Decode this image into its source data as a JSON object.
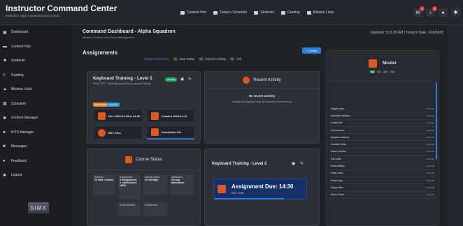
{
  "app": {
    "title": "Instructor Command Center",
    "subtitle": "Real-time class monitoring and control"
  },
  "topnav": [
    {
      "label": "Content Hub",
      "icon": "monitor-icon"
    },
    {
      "label": "Today's Schedule",
      "icon": "calendar-icon"
    },
    {
      "label": "Students",
      "icon": "users-icon"
    },
    {
      "label": "Grading",
      "icon": "grading-icon"
    },
    {
      "label": "Mission Links",
      "icon": "link-icon"
    }
  ],
  "topicons": {
    "mail_badge": "0",
    "bell_badge": "0"
  },
  "sidebar": {
    "items": [
      {
        "label": "Dashboard"
      },
      {
        "label": "Content Hub"
      },
      {
        "label": "Students"
      },
      {
        "label": "Grading"
      },
      {
        "label": "Mission Links"
      },
      {
        "label": "Schedule"
      },
      {
        "label": "Content Manager"
      },
      {
        "label": "KITS Manager"
      },
      {
        "label": "Messages"
      },
      {
        "label": "Feedback"
      },
      {
        "label": "Logout"
      }
    ],
    "logo_text": "SIMX"
  },
  "header": {
    "title": "Command Dashboard - Alpha Squadron",
    "subtitle": "Mission Control • Live Class Management",
    "updated": "Updated: 9:21:26 AM  |  Today's Date: 1/28/2026"
  },
  "assignments": {
    "title": "Assignments",
    "create_label": "+ Create",
    "tabs": [
      {
        "label": "Today's Summary",
        "num": ""
      },
      {
        "label": "Due Today",
        "num": "2"
      },
      {
        "label": "Recent Activity",
        "num": "0"
      },
      {
        "label": "List",
        "num": "3"
      }
    ]
  },
  "card1": {
    "title": "Keyboard Training - Level 1",
    "desc": "PRACTICE - Basic typing skills and accuracy training",
    "status": "ACTIVE",
    "pill_pdf": "PDF Upload",
    "pill_practical": "Practical",
    "stats": [
      "Due 2024-01-15 at 14:30",
      "Created 2024-01-10",
      "EST: 25m",
      "Submitted: 6/8"
    ]
  },
  "recent": {
    "title": "Recent Activity",
    "msg1": "No recent activity",
    "msg2": "Activity will appear here as students submit work"
  },
  "course": {
    "title": "Course Status",
    "tiles": [
      {
        "label": "Students",
        "value": "25 total, 0 active"
      },
      {
        "label": "Assignments",
        "value": "0 assignments, 0 submissions (45%)"
      },
      {
        "label": "Average grade",
        "value": "0% average"
      },
      {
        "label": "Attendance",
        "value": "0% avg attendance"
      },
      {
        "label": "At-risk students",
        "value": ""
      },
      {
        "label": "Overall trend",
        "value": ""
      }
    ]
  },
  "card2": {
    "title": "Keyboard Training - Level 2",
    "due_title": "Assignment Due: 14:30",
    "due_sub": "EST: 34M"
  },
  "muster": {
    "title": "Muster",
    "filters": [
      "All",
      "IN",
      "AP",
      "OU"
    ],
    "students": [
      {
        "name": "Abigail Lopez",
        "status": "OFFLINE"
      },
      {
        "name": "Alexander Martinez",
        "status": "OFFLINE"
      },
      {
        "name": "Amelia Hall",
        "status": "OFFLINE"
      },
      {
        "name": "Ava Anderson",
        "status": "OFFLINE"
      },
      {
        "name": "Benjamin Martinez",
        "status": "OFFLINE"
      },
      {
        "name": "Charlotte White",
        "status": "OFFLINE"
      },
      {
        "name": "Daniel Sanders",
        "status": "OFFLINE"
      },
      {
        "name": "Ella Green",
        "status": "OFFLINE"
      },
      {
        "name": "Emma Wilson",
        "status": "OFFLINE"
      },
      {
        "name": "Ethan Lewis",
        "status": "OFFLINE"
      },
      {
        "name": "Evelyn King",
        "status": "OFFLINE"
      },
      {
        "name": "Harper Allen",
        "status": "OFFLINE"
      },
      {
        "name": "Henry Garcia",
        "status": "OFFLINE"
      }
    ]
  }
}
